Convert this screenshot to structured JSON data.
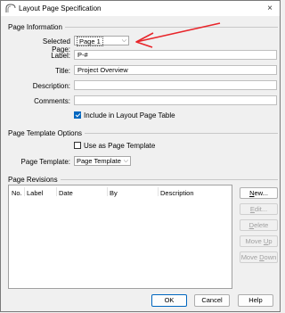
{
  "window": {
    "title": "Layout Page Specification",
    "close_glyph": "×"
  },
  "page_information": {
    "heading": "Page Information",
    "selected_page_label": "Selected Page:",
    "selected_page_value": "Page 1",
    "label_label": "Label:",
    "label_value": "P-#",
    "title_label": "Title:",
    "title_value": "Project Overview",
    "description_label": "Description:",
    "description_value": "",
    "comments_label": "Comments:",
    "comments_value": "",
    "include_label": "Include in Layout Page Table",
    "include_checked": true
  },
  "page_template_options": {
    "heading": "Page Template Options",
    "use_as_template_label": "Use as Page Template",
    "use_as_template_checked": false,
    "page_template_label": "Page Template:",
    "page_template_value": "Page Template"
  },
  "page_revisions": {
    "heading": "Page Revisions",
    "columns": [
      "No.",
      "Label",
      "Date",
      "By",
      "Description"
    ],
    "rows": [],
    "buttons": {
      "new": {
        "pre": "",
        "key": "N",
        "post": "ew...",
        "enabled": true
      },
      "edit": {
        "pre": "",
        "key": "E",
        "post": "dit...",
        "enabled": false
      },
      "delete": {
        "pre": "",
        "key": "D",
        "post": "elete",
        "enabled": false
      },
      "move_up": {
        "pre": "Move ",
        "key": "U",
        "post": "p",
        "enabled": false
      },
      "move_down": {
        "pre": "Move ",
        "key": "D",
        "post": "own",
        "enabled": false
      }
    }
  },
  "footer": {
    "ok": "OK",
    "cancel": "Cancel",
    "help": "Help"
  },
  "colors": {
    "accent": "#0067c0",
    "annotation_arrow": "#e8252a"
  },
  "icons": {
    "app_icon": "chief-architect-logo-icon",
    "dropdown": "chevron-down-icon"
  }
}
